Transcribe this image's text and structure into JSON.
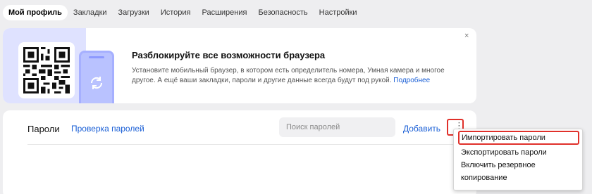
{
  "tabs": [
    {
      "label": "Мой профиль",
      "active": true
    },
    {
      "label": "Закладки"
    },
    {
      "label": "Загрузки"
    },
    {
      "label": "История"
    },
    {
      "label": "Расширения"
    },
    {
      "label": "Безопасность"
    },
    {
      "label": "Настройки"
    }
  ],
  "banner": {
    "title": "Разблокируйте все возможности браузера",
    "text": "Установите мобильный браузер, в котором есть определитель номера, Умная камера и многое другое. А ещё ваши закладки, пароли и другие данные всегда будут под рукой.",
    "link": "Подробнее",
    "close": "×"
  },
  "passwords": {
    "title": "Пароли",
    "check_link": "Проверка паролей",
    "search_placeholder": "Поиск паролей",
    "add_label": "Добавить",
    "more_glyph": "⋮"
  },
  "menu": {
    "items": [
      {
        "label": "Импортировать пароли"
      },
      {
        "label": "Экспортировать пароли"
      },
      {
        "label": "Включить резервное копирование"
      }
    ]
  },
  "colors": {
    "accent": "#1a5fd6",
    "highlight": "#e0302a",
    "banner_art_bg": "#dfe2ff"
  },
  "icons": {
    "qr": "qr-code-icon",
    "phone": "phone-icon",
    "sync": "sync-icon",
    "close": "close-icon",
    "more": "more-vertical-icon"
  }
}
